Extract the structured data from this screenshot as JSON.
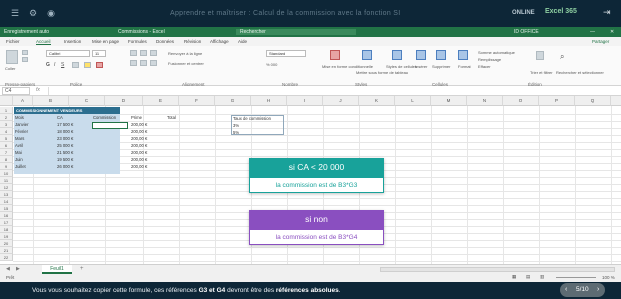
{
  "top": {
    "video_title": "Apprendre et maîtriser : Calcul de la commission avec la fonction SI",
    "online_label": "ONLINE",
    "app_label": "Excel 365",
    "exit_icon": "exit-icon"
  },
  "titlebar": {
    "left": "Enregistrement auto",
    "file": "Commissions - Excel",
    "search": "Rechercher",
    "user": "ID OFFICE"
  },
  "menu": {
    "items": [
      "Fichier",
      "Accueil",
      "Insertion",
      "Mise en page",
      "Formules",
      "Données",
      "Révision",
      "Affichage",
      "Aide"
    ],
    "share": "Partager"
  },
  "ribbon": {
    "groups": [
      "Presse-papiers",
      "Police",
      "Alignement",
      "Nombre",
      "Styles",
      "Cellules",
      "Édition"
    ],
    "paste": "Coller",
    "font_name": "Calibri",
    "font_size": "11",
    "wrap": "Renvoyer à la ligne",
    "merge": "Fusionner et centrer",
    "number_format": "Standard",
    "cond_format": "Mise en forme conditionnelle",
    "as_table": "Mettre sous forme de tableau",
    "cell_styles": "Styles de cellules",
    "insert": "Insérer",
    "delete": "Supprimer",
    "format": "Format",
    "autosum": "Somme automatique",
    "fill": "Remplissage",
    "clear": "Effacer",
    "sort": "Trier et filtrer",
    "find": "Rechercher et sélectionner"
  },
  "formula": {
    "namebox": "C4",
    "fx": "fx"
  },
  "columns": [
    "A",
    "B",
    "C",
    "D",
    "E",
    "F",
    "G",
    "H",
    "I",
    "J",
    "K",
    "L",
    "M",
    "N",
    "O",
    "P",
    "Q",
    "R"
  ],
  "rows": [
    "1",
    "2",
    "3",
    "4",
    "5",
    "6",
    "7",
    "8",
    "9",
    "10",
    "11",
    "12",
    "13",
    "14",
    "15",
    "16",
    "17",
    "18",
    "19",
    "20",
    "21",
    "22"
  ],
  "sheet": {
    "title": "COMMISSIONNEMENT VENDEURS",
    "headers": [
      "Mois",
      "CA",
      "Commission",
      "Prime",
      "Total"
    ],
    "months": [
      "Janvier",
      "Février",
      "Mars",
      "Avril",
      "Mai",
      "Juin",
      "Juillet"
    ],
    "ca": [
      "17 500 €",
      "18 000 €",
      "23 000 €",
      "25 000 €",
      "21 500 €",
      "19 500 €",
      "26 000 €"
    ],
    "prime": [
      "200,00 €",
      "200,00 €",
      "200,00 €",
      "200,00 €",
      "200,00 €",
      "200,00 €",
      "200,00 €"
    ],
    "taux_label": "Taux de commission",
    "taux": [
      "3%",
      "5%"
    ]
  },
  "callouts": {
    "if_head": "si CA < 20 000",
    "if_body": "la commission est de B3*G3",
    "else_head": "si non",
    "else_body": "la commission est de B3*G4"
  },
  "tabs": {
    "sheet": "Feuil1",
    "add": "+"
  },
  "status": {
    "ready": "Prêt",
    "zoom": "100 %"
  },
  "subtitle": {
    "before": "Vous vous souhaitez copier cette formule, ces références ",
    "refs": "G3 et G4",
    "middle": " devront être des ",
    "emph": "références absolues",
    "after": "."
  },
  "pager": {
    "label": "5/10"
  }
}
